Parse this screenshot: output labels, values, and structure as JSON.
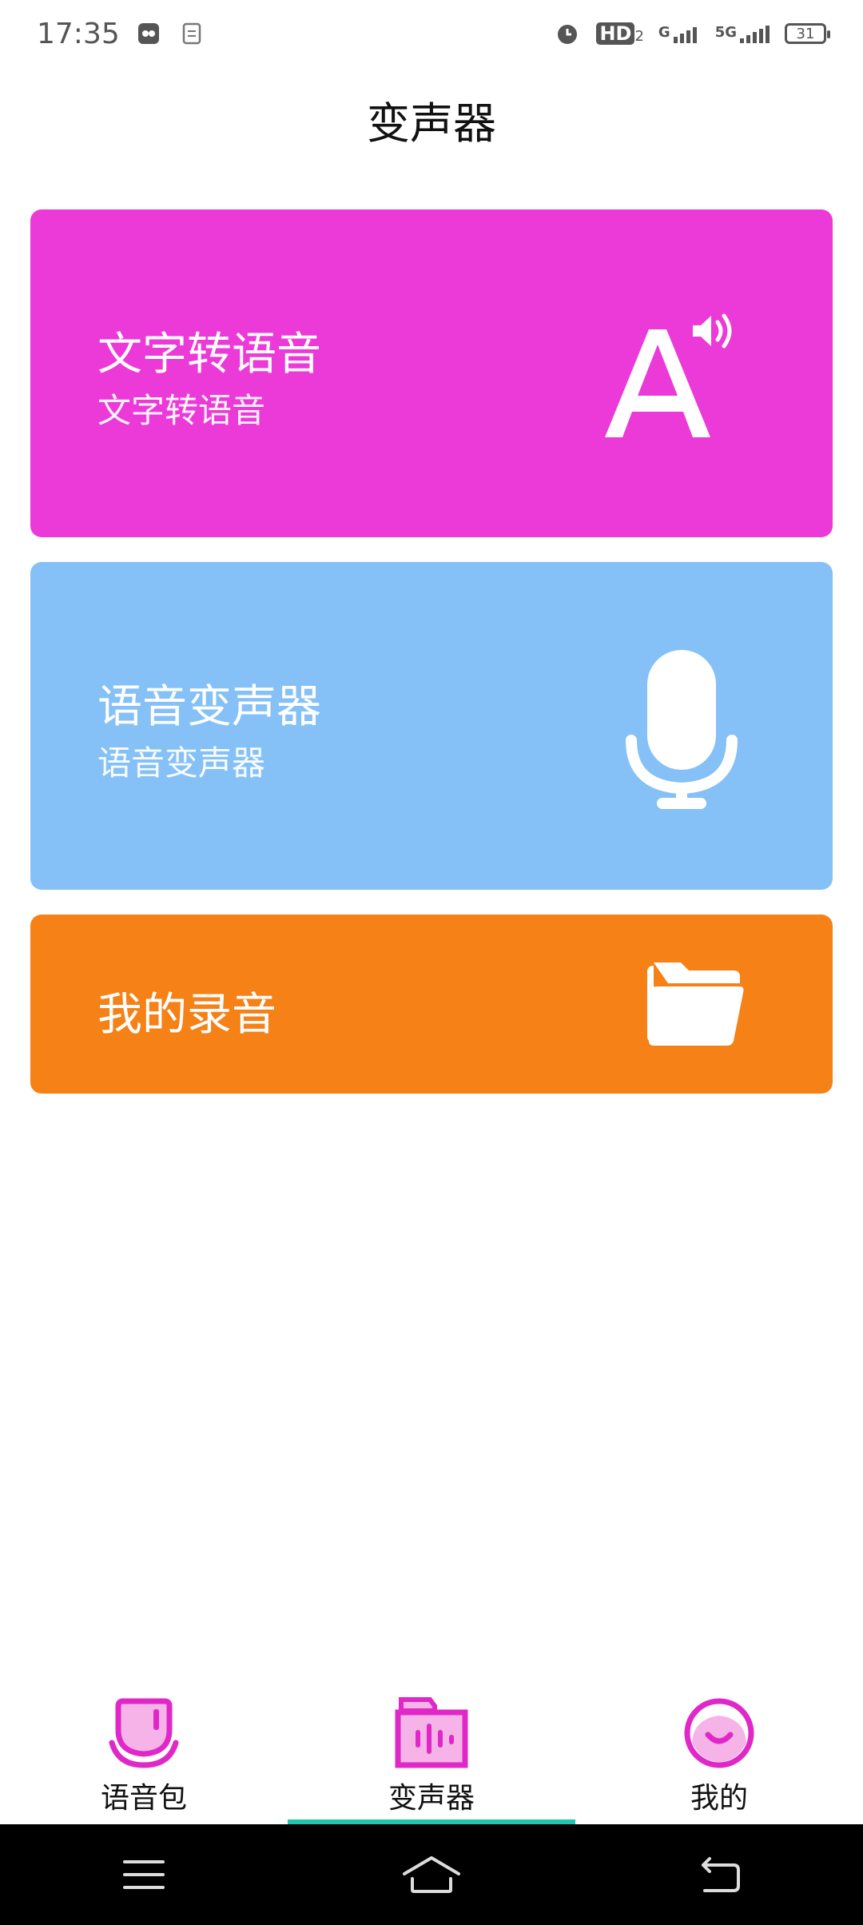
{
  "status_bar": {
    "time": "17:35",
    "signal_g": "G",
    "signal_5g": "5G",
    "hd": "HD",
    "hd_sub": "2",
    "battery": "31"
  },
  "header": {
    "title": "变声器"
  },
  "cards": [
    {
      "title": "文字转语音",
      "subtitle": "文字转语音",
      "icon": "text-to-speech-icon",
      "color": "#ec3ad8"
    },
    {
      "title": "语音变声器",
      "subtitle": "语音变声器",
      "icon": "microphone-icon",
      "color": "#85c1f6"
    },
    {
      "title": "我的录音",
      "icon": "folder-icon",
      "color": "#f58117"
    }
  ],
  "tabs": [
    {
      "label": "语音包",
      "icon": "voice-pack-icon"
    },
    {
      "label": "变声器",
      "icon": "voice-changer-icon",
      "active": true
    },
    {
      "label": "我的",
      "icon": "profile-icon"
    }
  ],
  "colors": {
    "accent": "#ec3ad8",
    "tab_indicator": "#20c6b0"
  }
}
